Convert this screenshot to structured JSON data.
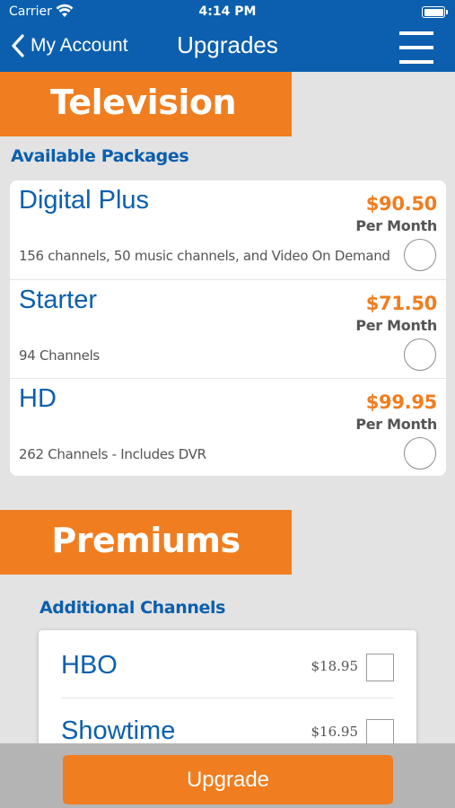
{
  "status_bar": {
    "carrier": "Carrier",
    "time": "4:14 PM"
  },
  "nav": {
    "back_label": "My Account",
    "title": "Upgrades"
  },
  "television": {
    "banner_title": "Television",
    "section_label": "Available Packages",
    "packages": [
      {
        "name": "Digital Plus",
        "description": "156 channels, 50 music channels, and Video On Demand",
        "price": "$90.50",
        "period": "Per Month"
      },
      {
        "name": "Starter",
        "description": "94 Channels",
        "price": "$71.50",
        "period": "Per Month"
      },
      {
        "name": "HD",
        "description": "262 Channels - Includes DVR",
        "price": "$99.95",
        "period": "Per Month"
      }
    ]
  },
  "premiums": {
    "banner_title": "Premiums",
    "section_label": "Additional Channels",
    "channels": [
      {
        "name": "HBO",
        "price": "$18.95"
      },
      {
        "name": "Showtime",
        "price": "$16.95"
      }
    ]
  },
  "footer": {
    "upgrade_label": "Upgrade"
  },
  "colors": {
    "brand_blue": "#0b5fae",
    "accent_orange": "#f07d1f",
    "background": "#e3e3e3"
  }
}
